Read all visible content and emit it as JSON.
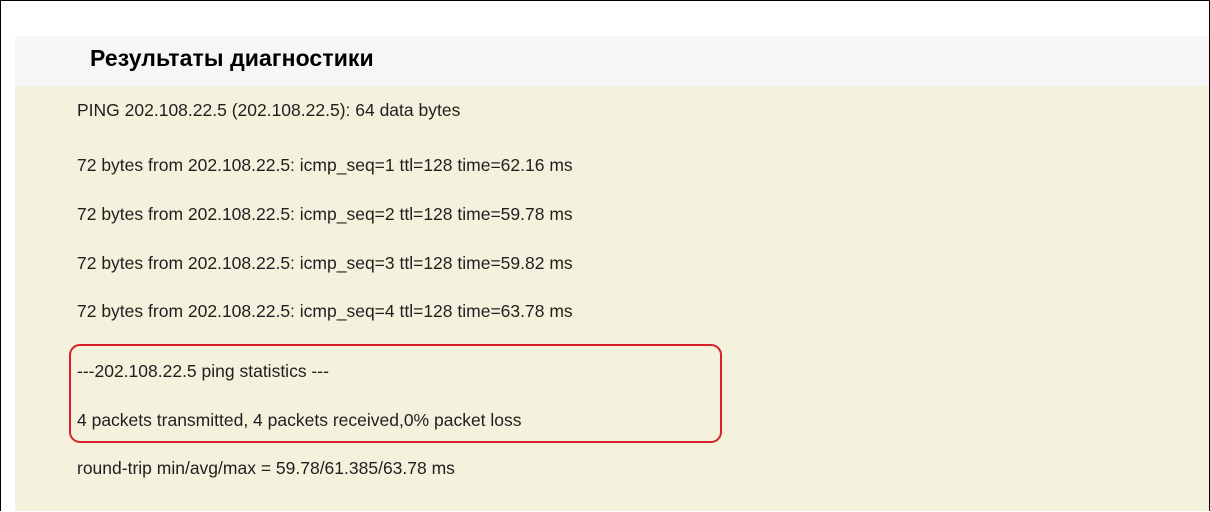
{
  "panel": {
    "title": "Результаты диагностики"
  },
  "output": {
    "header_line": "PING 202.108.22.5 (202.108.22.5): 64 data bytes",
    "replies": [
      "72 bytes from 202.108.22.5: icmp_seq=1 ttl=128 time=62.16 ms",
      "72 bytes from 202.108.22.5: icmp_seq=2 ttl=128 time=59.78 ms",
      "72 bytes from 202.108.22.5: icmp_seq=3 ttl=128 time=59.82 ms",
      "72 bytes from 202.108.22.5: icmp_seq=4 ttl=128 time=63.78 ms"
    ],
    "statistics_header": "---202.108.22.5 ping statistics ---",
    "statistics_summary": "4 packets transmitted, 4 packets received,0% packet loss",
    "round_trip": "round-trip min/avg/max = 59.78/61.385/63.78 ms"
  },
  "colors": {
    "panel_background": "#f4f2dc",
    "header_background": "#f6f6f6",
    "highlight_border": "#d6202a",
    "text": "#1f1f1f"
  }
}
